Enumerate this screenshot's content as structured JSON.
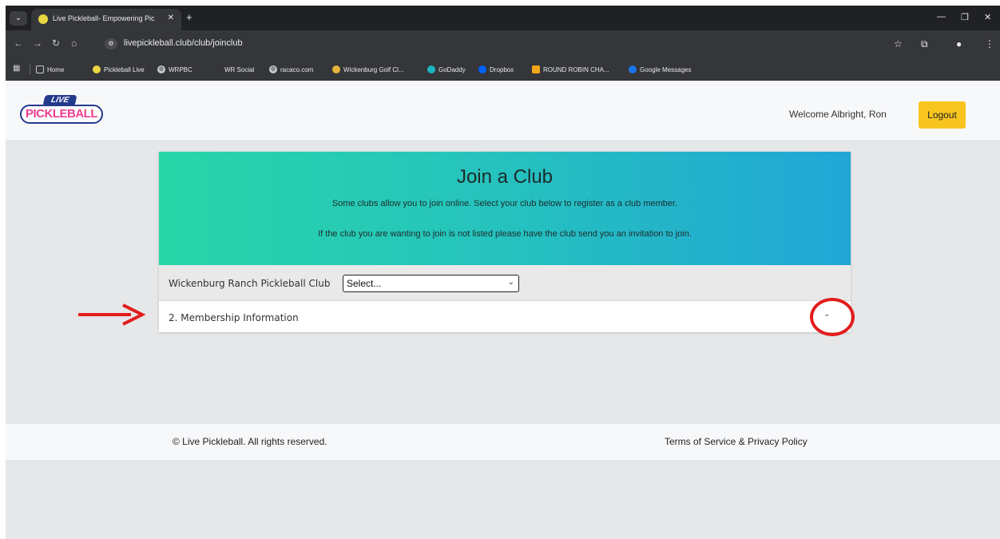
{
  "browser": {
    "tab_title": "Live Pickleball- Empowering Pic",
    "tab_close": "✕",
    "new_tab": "+",
    "url": "livepickleball.club/club/joinclub",
    "bookmarks": [
      {
        "label": "Home",
        "icon": "folder-icon",
        "color": "#c7c9cc"
      },
      {
        "label": "Pickleball Live",
        "icon": "pickleball-favicon",
        "color": "#e8d642"
      },
      {
        "label": "WRPBC",
        "icon": "globe-icon",
        "color": "#c7c9cc"
      },
      {
        "label": "WR Social",
        "icon": "blank-favicon",
        "color": "#35363a"
      },
      {
        "label": "racaco.com",
        "icon": "globe-icon",
        "color": "#c7c9cc"
      },
      {
        "label": "Wickenburg Golf Cl...",
        "icon": "golf-favicon",
        "color": "#e2b43b"
      },
      {
        "label": "GoDaddy",
        "icon": "godaddy-favicon",
        "color": "#1bb6c2"
      },
      {
        "label": "Dropbox",
        "icon": "dropbox-favicon",
        "color": "#0061fe"
      },
      {
        "label": "ROUND ROBIN CHA...",
        "icon": "roundrobin-favicon",
        "color": "#f2a71b"
      },
      {
        "label": "Google Messages",
        "icon": "messages-favicon",
        "color": "#1a73e8"
      }
    ]
  },
  "header": {
    "logo_live": "LIVE",
    "logo_main": "PICKLEBALL",
    "welcome": "Welcome Albright, Ron",
    "logout_label": "Logout"
  },
  "hero": {
    "title": "Join a Club",
    "line1": "Some clubs allow you to join online.  Select your club below to register as a club member.",
    "line2": "If the club you are wanting to join is not listed please have the club send you an invitation to join."
  },
  "club": {
    "label": "Wickenburg Ranch Pickleball Club",
    "select_value": "Select..."
  },
  "section": {
    "label": "2. Membership Information"
  },
  "footer": {
    "copyright": "© Live Pickleball. All rights reserved.",
    "terms": "Terms of Service & Privacy Policy"
  },
  "colors": {
    "accent_yellow": "#f7c51e",
    "annotation_red": "#e31d1d",
    "gradient_start": "#28d6a8",
    "gradient_end": "#21a6d6"
  }
}
